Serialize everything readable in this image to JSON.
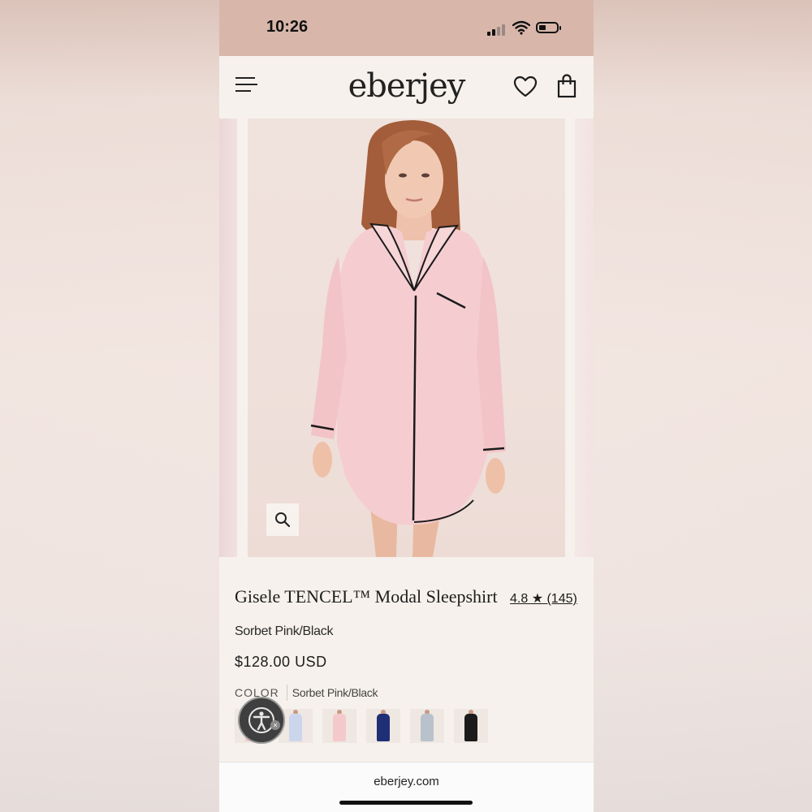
{
  "status_bar": {
    "time": "10:26"
  },
  "header": {
    "logo": "eberjey"
  },
  "icons": {
    "menu": "hamburger-menu-icon",
    "wishlist": "heart-icon",
    "cart": "shopping-bag-icon",
    "zoom": "magnifier-icon",
    "accessibility": "accessibility-person-icon"
  },
  "product": {
    "title": "Gisele TENCEL™ Modal Sleepshirt",
    "rating": "4.8 ★ (145)",
    "variant": "Sorbet Pink/Black",
    "price": "$128.00 USD",
    "color_label": "COLOR",
    "color_value": "Sorbet Pink/Black"
  },
  "swatches": [
    {
      "color": "#f3c9c8"
    },
    {
      "color": "#cbd6ec"
    },
    {
      "color": "#f4c9cc"
    },
    {
      "color": "#1f2f75"
    },
    {
      "color": "#b9c2cc"
    },
    {
      "color": "#1b1b1b"
    }
  ],
  "browser": {
    "url": "eberjey.com"
  },
  "colors": {
    "status_bar_bg": "#d8b7aa",
    "page_bg": "#f6f1ec",
    "garment_pink": "#f5cdd0",
    "piping": "#1b1b1b"
  }
}
